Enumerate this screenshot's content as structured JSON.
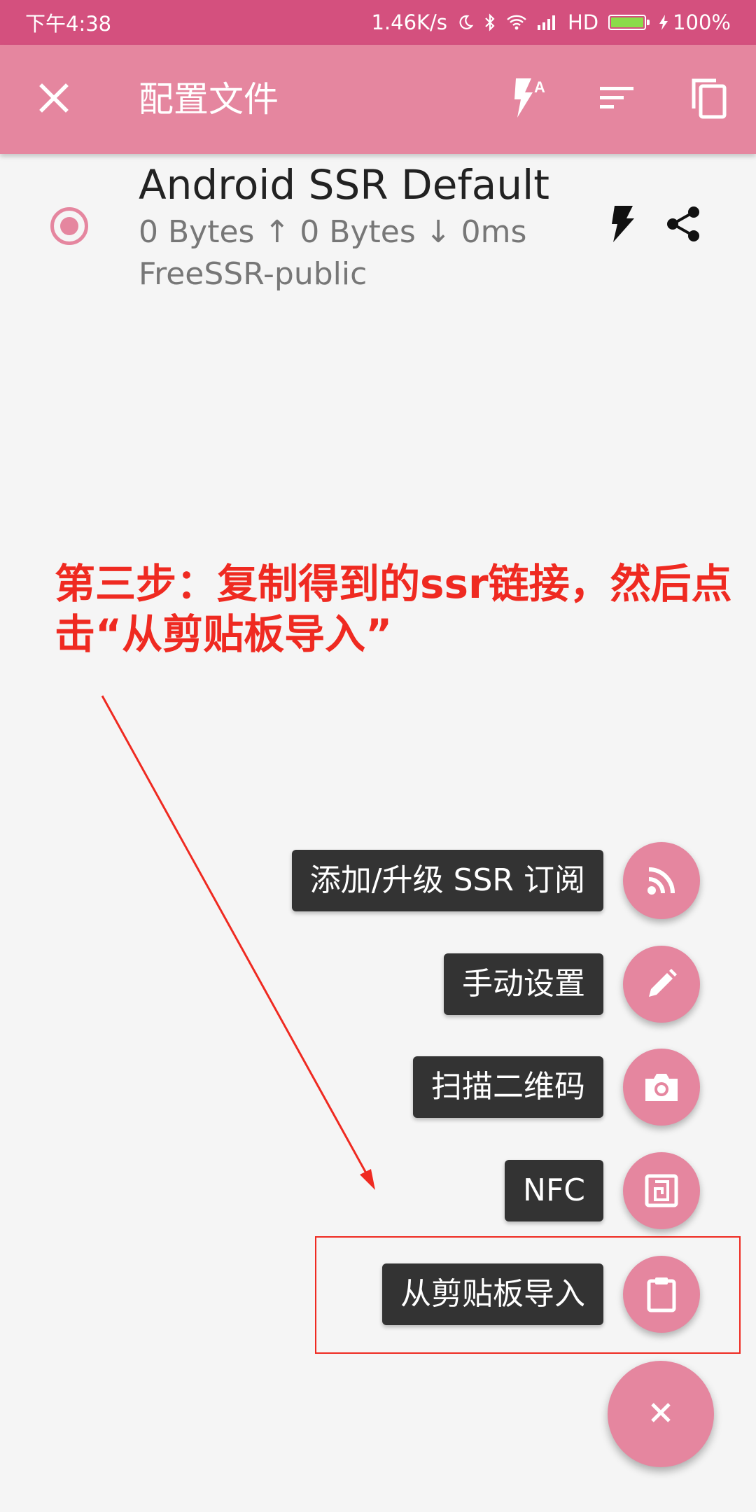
{
  "status_bar": {
    "time": "下午4:38",
    "net_speed": "1.46K/s",
    "network_type": "HD",
    "battery_percent": "100%",
    "battery_level": 1.0,
    "icons": [
      "moon-icon",
      "bluetooth-icon",
      "wifi-icon",
      "signal-icon",
      "battery-icon",
      "charging-icon"
    ]
  },
  "toolbar": {
    "title": "配置文件",
    "background": "#e5869f",
    "icons": [
      "close-icon",
      "flash-auto-icon",
      "sort-icon",
      "copy-icon"
    ]
  },
  "profile": {
    "name": "Android SSR Default",
    "stats": "0 Bytes ↑ 0 Bytes ↓ 0ms",
    "group": "FreeSSR-public",
    "selected": true,
    "icons": [
      "radio-selected-icon",
      "flash-icon",
      "share-icon"
    ]
  },
  "annotation": {
    "text": "第三步：复制得到的ssr链接，然后点击“从剪贴板导入”",
    "color": "#ef2a21"
  },
  "fab_menu": {
    "items": [
      {
        "label": "添加/升级 SSR 订阅",
        "icon": "rss-icon"
      },
      {
        "label": "手动设置",
        "icon": "pencil-icon"
      },
      {
        "label": "扫描二维码",
        "icon": "camera-icon"
      },
      {
        "label": "NFC",
        "icon": "nfc-icon"
      },
      {
        "label": "从剪贴板导入",
        "icon": "clipboard-icon"
      }
    ],
    "close_label": "×",
    "accent": "#e5869f"
  }
}
